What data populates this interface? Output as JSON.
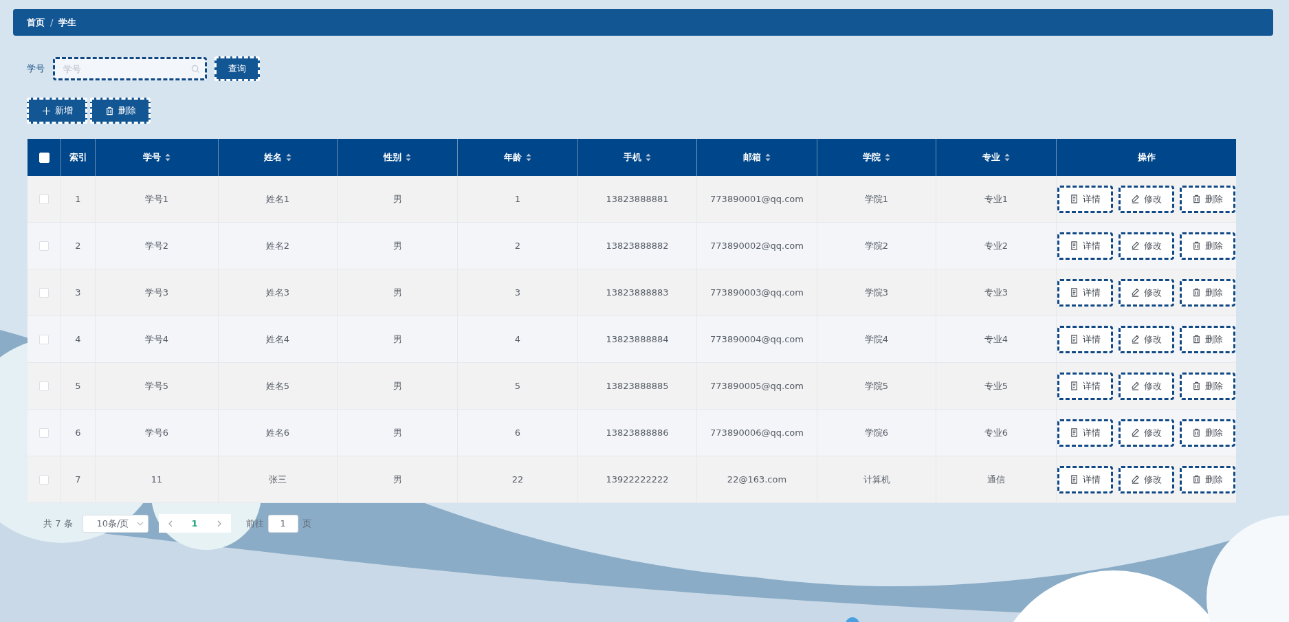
{
  "breadcrumb": [
    "首页",
    "学生"
  ],
  "breadcrumb_separator": "/",
  "search": {
    "label": "学号",
    "placeholder": "学号",
    "button": "查询"
  },
  "actions": [
    {
      "kind": "add",
      "label": "新增"
    },
    {
      "kind": "delete",
      "label": "删除"
    }
  ],
  "table": {
    "select_all_checked": false,
    "columns": [
      {
        "label": "索引",
        "sortable": false
      },
      {
        "label": "学号",
        "sortable": true
      },
      {
        "label": "姓名",
        "sortable": true
      },
      {
        "label": "性别",
        "sortable": true
      },
      {
        "label": "年龄",
        "sortable": true
      },
      {
        "label": "手机",
        "sortable": true
      },
      {
        "label": "邮箱",
        "sortable": true
      },
      {
        "label": "学院",
        "sortable": true
      },
      {
        "label": "专业",
        "sortable": true
      },
      {
        "label": "操作",
        "sortable": false
      }
    ],
    "rows": [
      {
        "checked": false,
        "cells": [
          "1",
          "学号1",
          "姓名1",
          "男",
          "1",
          "13823888881",
          "773890001@qq.com",
          "学院1",
          "专业1"
        ],
        "actions": [
          {
            "kind": "detail",
            "label": "详情"
          },
          {
            "kind": "edit",
            "label": "修改"
          },
          {
            "kind": "delete",
            "label": "删除"
          }
        ]
      },
      {
        "checked": false,
        "cells": [
          "2",
          "学号2",
          "姓名2",
          "男",
          "2",
          "13823888882",
          "773890002@qq.com",
          "学院2",
          "专业2"
        ],
        "actions": [
          {
            "kind": "detail",
            "label": "详情"
          },
          {
            "kind": "edit",
            "label": "修改"
          },
          {
            "kind": "delete",
            "label": "删除"
          }
        ]
      },
      {
        "checked": false,
        "cells": [
          "3",
          "学号3",
          "姓名3",
          "男",
          "3",
          "13823888883",
          "773890003@qq.com",
          "学院3",
          "专业3"
        ],
        "actions": [
          {
            "kind": "detail",
            "label": "详情"
          },
          {
            "kind": "edit",
            "label": "修改"
          },
          {
            "kind": "delete",
            "label": "删除"
          }
        ]
      },
      {
        "checked": false,
        "cells": [
          "4",
          "学号4",
          "姓名4",
          "男",
          "4",
          "13823888884",
          "773890004@qq.com",
          "学院4",
          "专业4"
        ],
        "actions": [
          {
            "kind": "detail",
            "label": "详情"
          },
          {
            "kind": "edit",
            "label": "修改"
          },
          {
            "kind": "delete",
            "label": "删除"
          }
        ]
      },
      {
        "checked": false,
        "cells": [
          "5",
          "学号5",
          "姓名5",
          "男",
          "5",
          "13823888885",
          "773890005@qq.com",
          "学院5",
          "专业5"
        ],
        "actions": [
          {
            "kind": "detail",
            "label": "详情"
          },
          {
            "kind": "edit",
            "label": "修改"
          },
          {
            "kind": "delete",
            "label": "删除"
          }
        ]
      },
      {
        "checked": false,
        "cells": [
          "6",
          "学号6",
          "姓名6",
          "男",
          "6",
          "13823888886",
          "773890006@qq.com",
          "学院6",
          "专业6"
        ],
        "actions": [
          {
            "kind": "detail",
            "label": "详情"
          },
          {
            "kind": "edit",
            "label": "修改"
          },
          {
            "kind": "delete",
            "label": "删除"
          }
        ]
      },
      {
        "checked": false,
        "cells": [
          "7",
          "11",
          "张三",
          "男",
          "22",
          "13922222222",
          "22@163.com",
          "计算机",
          "通信"
        ],
        "actions": [
          {
            "kind": "detail",
            "label": "详情"
          },
          {
            "kind": "edit",
            "label": "修改"
          },
          {
            "kind": "delete",
            "label": "删除"
          }
        ]
      }
    ]
  },
  "pagination": {
    "total": "共 7 条",
    "page_size": "10条/页",
    "pages": [
      {
        "label": "1",
        "selected": true
      }
    ],
    "goto_label": "前往",
    "goto_value": "1",
    "goto_suffix": "页"
  }
}
